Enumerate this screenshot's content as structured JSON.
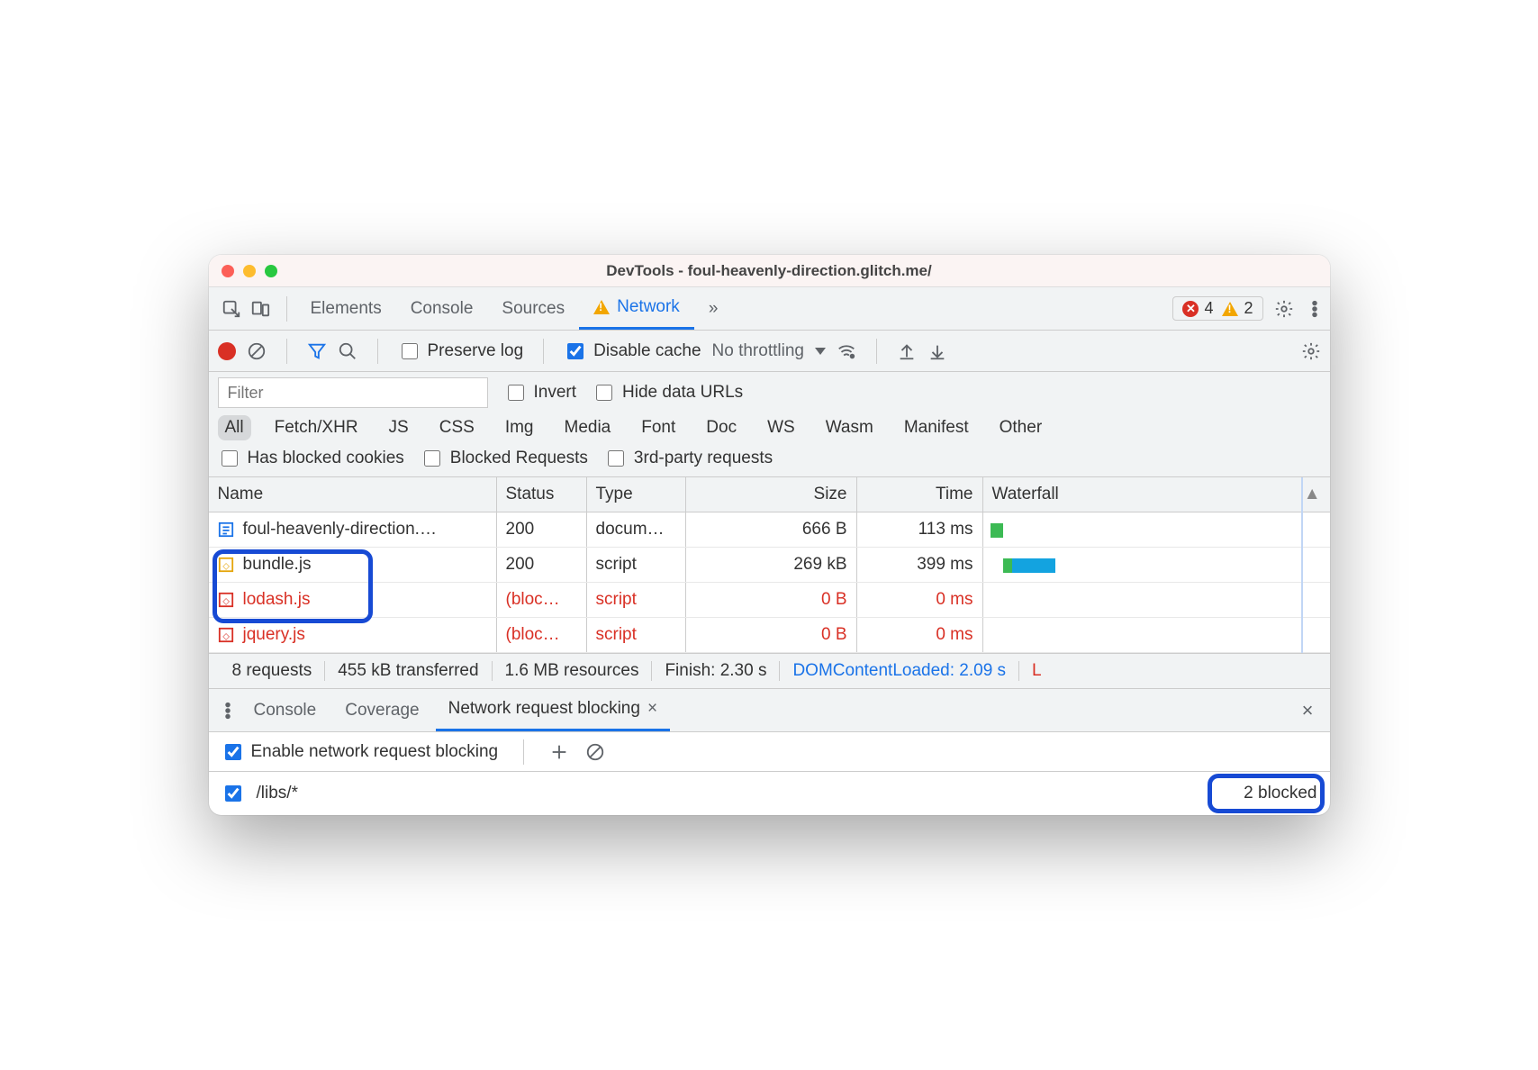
{
  "window": {
    "title": "DevTools - foul-heavenly-direction.glitch.me/"
  },
  "tabs": {
    "elements": "Elements",
    "console": "Console",
    "sources": "Sources",
    "network": "Network",
    "more": "»"
  },
  "counts": {
    "errors": "4",
    "warnings": "2"
  },
  "toolbar": {
    "preserve_log": "Preserve log",
    "disable_cache": "Disable cache",
    "throttling": "No throttling"
  },
  "filter": {
    "placeholder": "Filter",
    "invert": "Invert",
    "hide_data_urls": "Hide data URLs",
    "types": [
      "All",
      "Fetch/XHR",
      "JS",
      "CSS",
      "Img",
      "Media",
      "Font",
      "Doc",
      "WS",
      "Wasm",
      "Manifest",
      "Other"
    ],
    "has_blocked_cookies": "Has blocked cookies",
    "blocked_requests": "Blocked Requests",
    "third_party": "3rd-party requests"
  },
  "columns": {
    "name": "Name",
    "status": "Status",
    "type": "Type",
    "size": "Size",
    "time": "Time",
    "waterfall": "Waterfall"
  },
  "rows": [
    {
      "name": "foul-heavenly-direction.…",
      "status": "200",
      "type": "docum…",
      "size": "666 B",
      "time": "113 ms",
      "blocked": false,
      "icon": "doc"
    },
    {
      "name": "bundle.js",
      "status": "200",
      "type": "script",
      "size": "269 kB",
      "time": "399 ms",
      "blocked": false,
      "icon": "js-y"
    },
    {
      "name": "lodash.js",
      "status": "(bloc…",
      "type": "script",
      "size": "0 B",
      "time": "0 ms",
      "blocked": true,
      "icon": "js-r"
    },
    {
      "name": "jquery.js",
      "status": "(bloc…",
      "type": "script",
      "size": "0 B",
      "time": "0 ms",
      "blocked": true,
      "icon": "js-r"
    }
  ],
  "summary": {
    "requests": "8 requests",
    "transferred": "455 kB transferred",
    "resources": "1.6 MB resources",
    "finish": "Finish: 2.30 s",
    "dcl": "DOMContentLoaded: 2.09 s",
    "load": "L"
  },
  "drawer": {
    "tabs": {
      "console": "Console",
      "coverage": "Coverage",
      "blocking": "Network request blocking"
    },
    "enable_label": "Enable network request blocking",
    "pattern": "/libs/*",
    "blocked_count": "2 blocked"
  }
}
